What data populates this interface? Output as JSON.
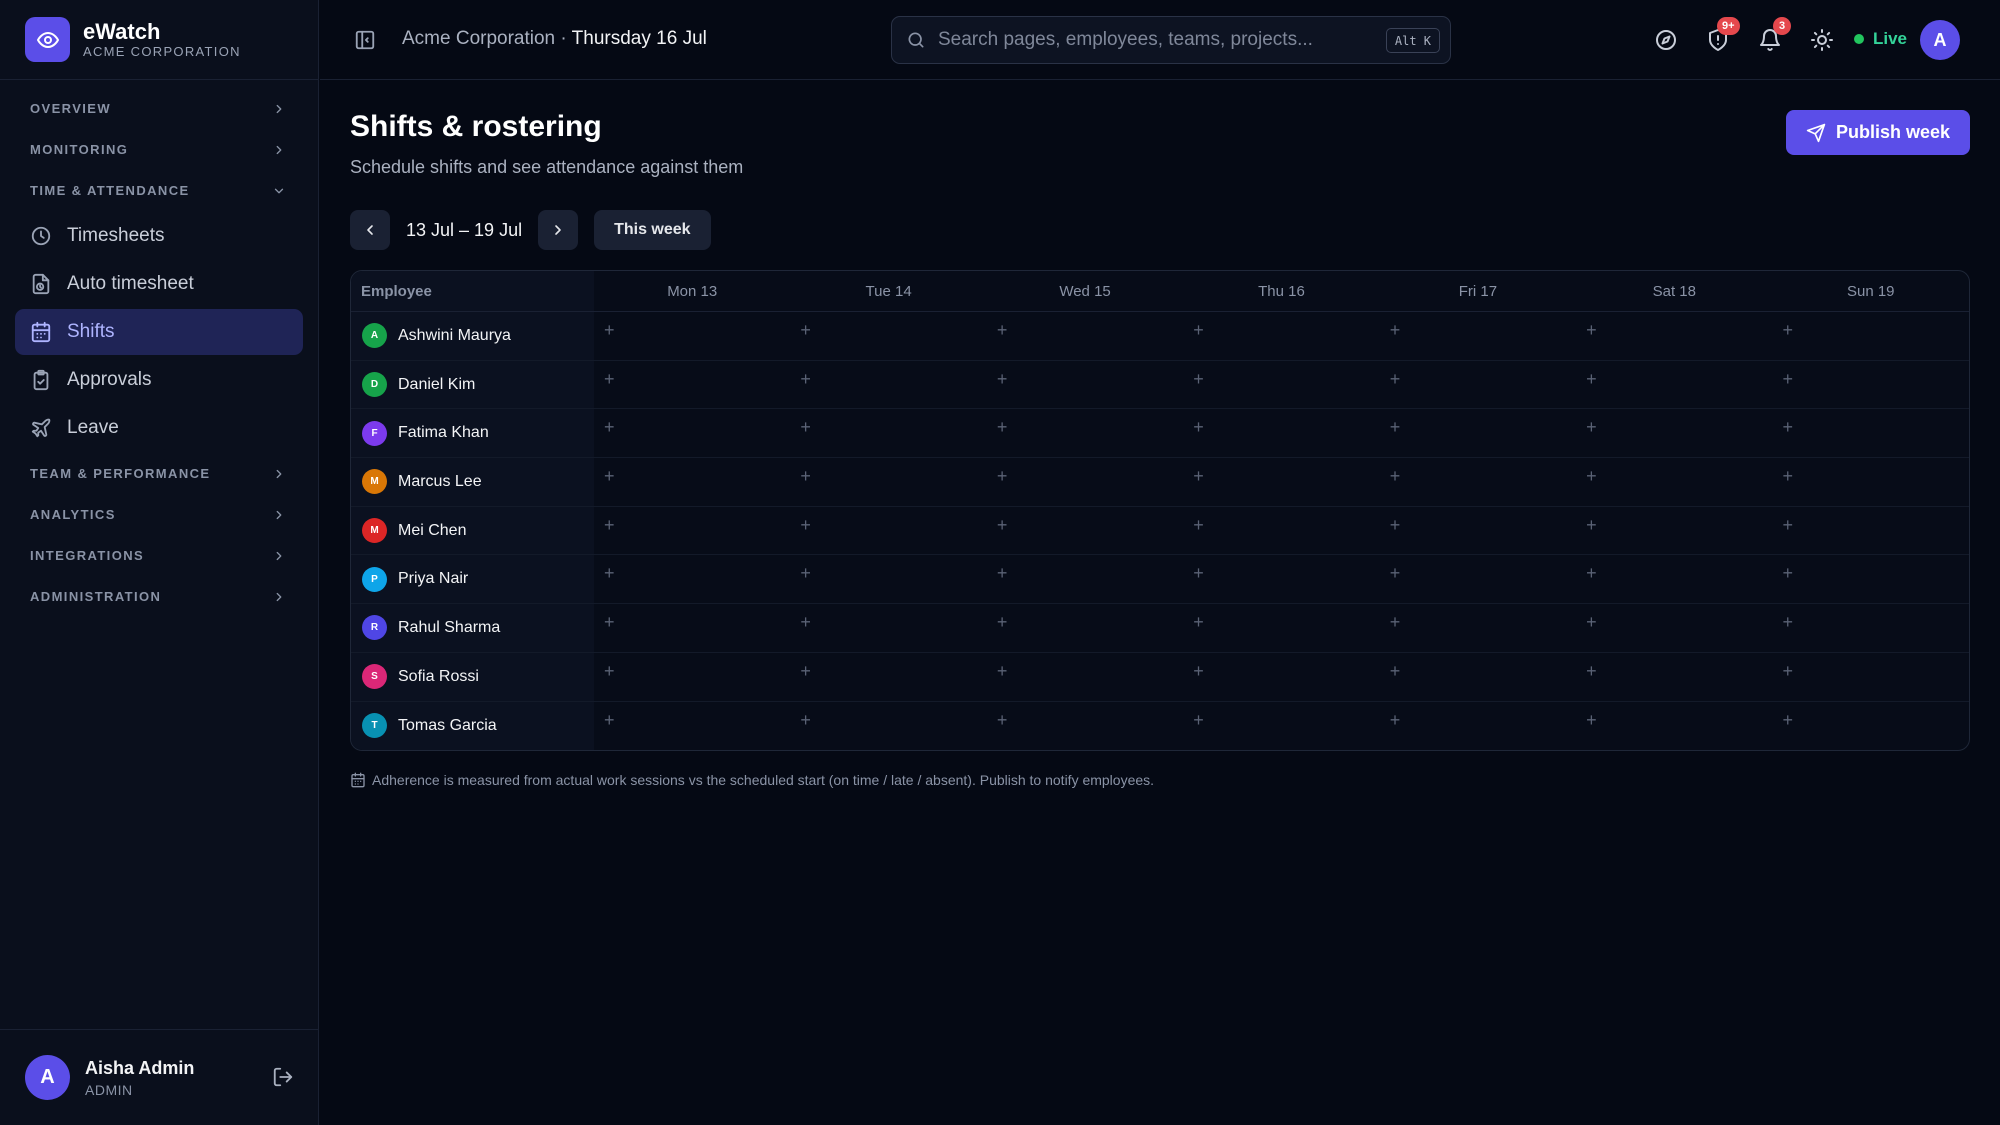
{
  "brand": {
    "name": "eWatch",
    "org": "ACME CORPORATION"
  },
  "sidebar": {
    "sections": [
      {
        "label": "OVERVIEW",
        "expanded": false
      },
      {
        "label": "MONITORING",
        "expanded": false
      },
      {
        "label": "TIME & ATTENDANCE",
        "expanded": true
      },
      {
        "label": "TEAM & PERFORMANCE",
        "expanded": false
      },
      {
        "label": "ANALYTICS",
        "expanded": false
      },
      {
        "label": "INTEGRATIONS",
        "expanded": false
      },
      {
        "label": "ADMINISTRATION",
        "expanded": false
      }
    ],
    "items": [
      {
        "label": "Timesheets",
        "icon": "clock-icon"
      },
      {
        "label": "Auto timesheet",
        "icon": "timer-file-icon"
      },
      {
        "label": "Shifts",
        "icon": "calendar-icon",
        "active": true
      },
      {
        "label": "Approvals",
        "icon": "clipboard-check-icon"
      },
      {
        "label": "Leave",
        "icon": "plane-icon"
      }
    ],
    "user": {
      "initial": "A",
      "name": "Aisha Admin",
      "role": "ADMIN"
    }
  },
  "topbar": {
    "org": "Acme Corporation",
    "separator": "·",
    "date": "Thursday 16 Jul",
    "search_placeholder": "Search pages, employees, teams, projects...",
    "shortcut": "Alt K",
    "shield_badge": "9+",
    "bell_badge": "3",
    "live_label": "Live",
    "avatar_initial": "A"
  },
  "page": {
    "title": "Shifts & rostering",
    "subtitle": "Schedule shifts and see attendance against them",
    "publish_label": "Publish week",
    "week_range": "13 Jul – 19 Jul",
    "this_week_label": "This week"
  },
  "grid": {
    "employee_header": "Employee",
    "days": [
      "Mon 13",
      "Tue 14",
      "Wed 15",
      "Thu 16",
      "Fri 17",
      "Sat 18",
      "Sun 19"
    ],
    "add_symbol": "+",
    "employees": [
      {
        "initial": "A",
        "name": "Ashwini Maurya",
        "color": "#16a34a"
      },
      {
        "initial": "D",
        "name": "Daniel Kim",
        "color": "#16a34a"
      },
      {
        "initial": "F",
        "name": "Fatima Khan",
        "color": "#7c3aed"
      },
      {
        "initial": "M",
        "name": "Marcus Lee",
        "color": "#d97706"
      },
      {
        "initial": "M",
        "name": "Mei Chen",
        "color": "#dc2626"
      },
      {
        "initial": "P",
        "name": "Priya Nair",
        "color": "#0ea5e9"
      },
      {
        "initial": "R",
        "name": "Rahul Sharma",
        "color": "#4f46e5"
      },
      {
        "initial": "S",
        "name": "Sofia Rossi",
        "color": "#db2777"
      },
      {
        "initial": "T",
        "name": "Tomas Garcia",
        "color": "#0891b2"
      }
    ]
  },
  "footnote": "Adherence is measured from actual work sessions vs the scheduled start (on time / late / absent). Publish to notify employees.",
  "colors": {
    "accent": "#5b4ee8",
    "live": "#22c55e",
    "badge": "#e5484d",
    "background": "#050914"
  }
}
